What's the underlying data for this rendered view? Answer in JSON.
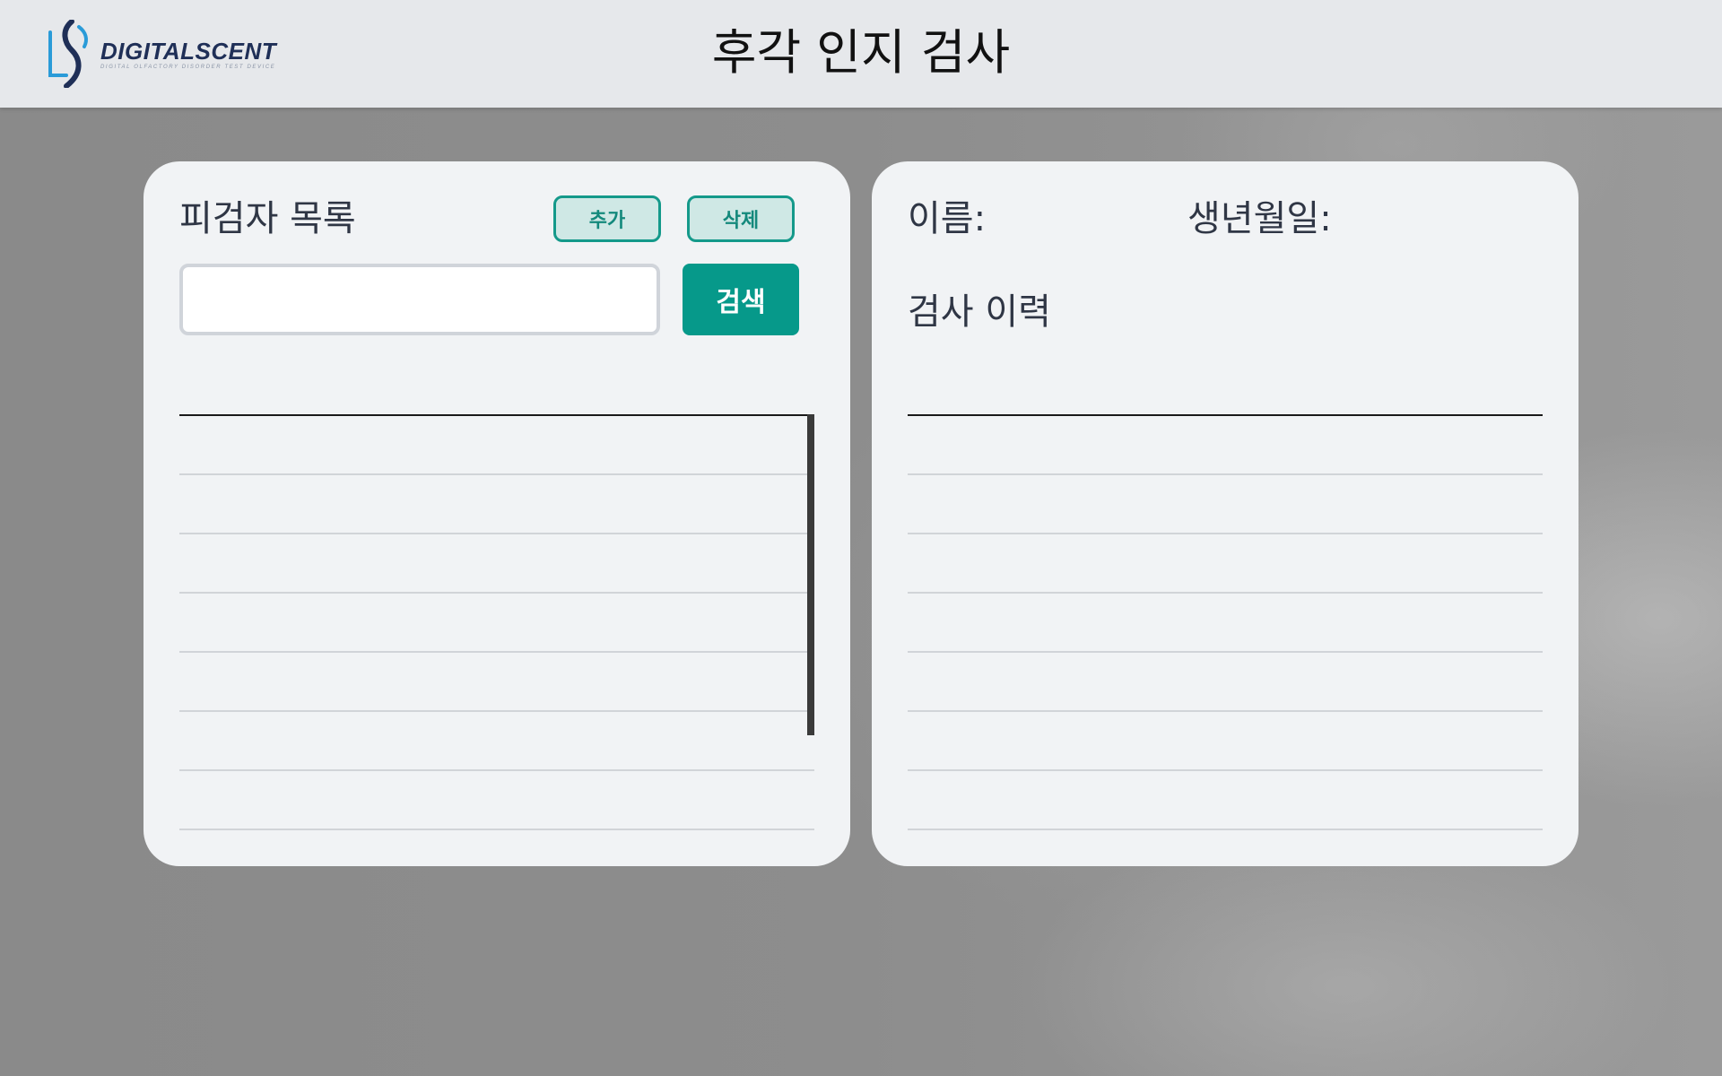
{
  "header": {
    "logo": {
      "name": "DIGITALSCENT",
      "tagline": "DIGITAL OLFACTORY DISORDER TEST DEVICE",
      "colors": {
        "word": "#1f2f57",
        "mark_blue": "#2a9bd8",
        "mark_navy": "#1f2f57"
      }
    },
    "title": "후각 인지 검사"
  },
  "subject_panel": {
    "heading": "피검자 목록",
    "add_label": "추가",
    "delete_label": "삭제",
    "search": {
      "value": "",
      "placeholder": ""
    },
    "search_label": "검색",
    "rows": [
      "",
      "",
      "",
      "",
      "",
      "",
      ""
    ]
  },
  "detail_panel": {
    "name_label": "이름:",
    "birth_label": "생년월일:",
    "history_heading": "검사 이력",
    "rows": [
      "",
      "",
      "",
      "",
      "",
      "",
      ""
    ]
  },
  "colors": {
    "accent": "#06998a",
    "accent_light": "#cfe8e5",
    "header_bg": "#e6e8eb",
    "card_bg": "#f1f3f5"
  }
}
